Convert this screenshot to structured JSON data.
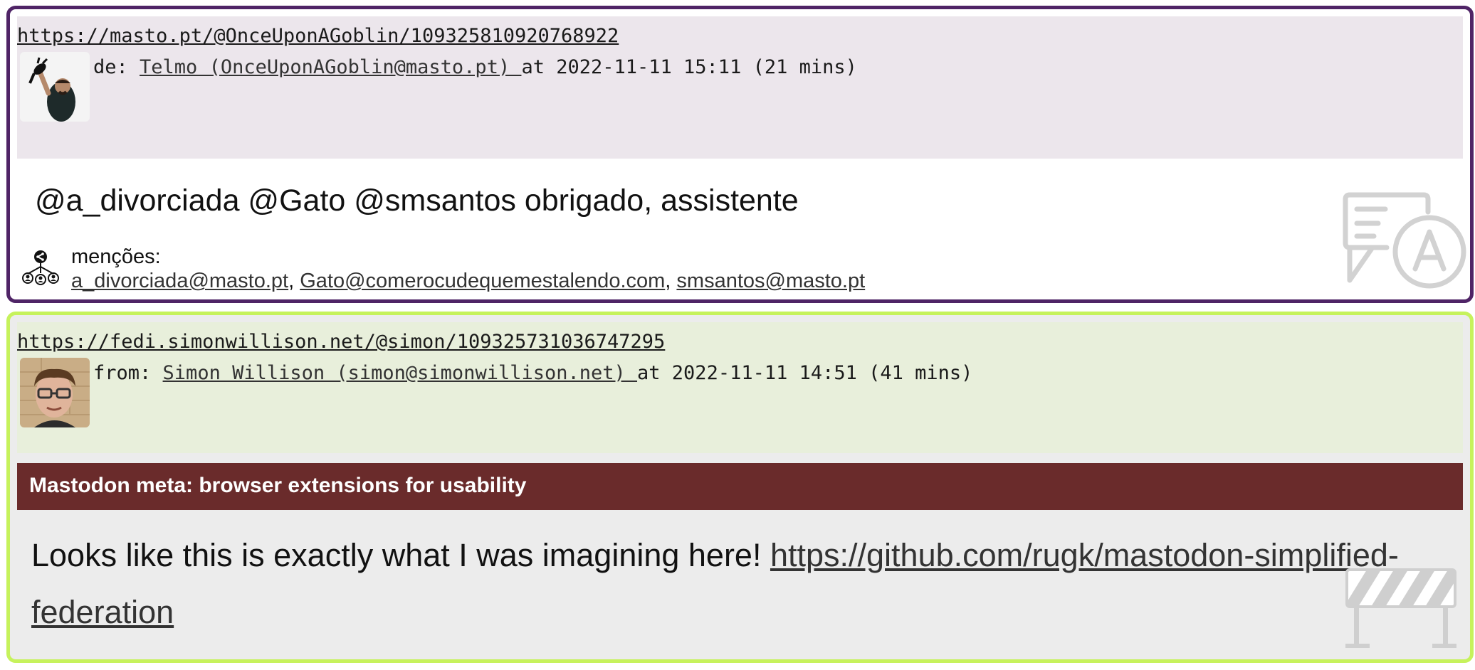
{
  "posts": [
    {
      "url": "https://masto.pt/@OnceUponAGoblin/109325810920768922",
      "from_label": "de: ",
      "author": "Telmo (OnceUponAGoblin@masto.pt) ",
      "at_text": "at 2022-11-11 15:11 (21 mins)",
      "content": "@a_divorciada @Gato @smsantos obrigado, assistente",
      "mentions_label": "menções:",
      "mentions": [
        "a_divorciada@masto.pt",
        "Gato@comerocudequemestalendo.com",
        "smsantos@masto.pt"
      ],
      "mention_separator": ", ",
      "border_color": "#4f2466",
      "header_bg": "#ece6ec",
      "avatar": "avatar-telmo-icon",
      "side_icon": "translate-icon"
    },
    {
      "url": "https://fedi.simonwillison.net/@simon/109325731036747295",
      "from_label": "from: ",
      "author": "Simon Willison (simon@simonwillison.net) ",
      "at_text": "at 2022-11-11 14:51 (41 mins)",
      "content_warning": "Mastodon meta: browser extensions for usability",
      "content_text": "Looks like this is exactly what I was imagining here! ",
      "content_link": "https://github.com/rugk/mastodon-simplified-federation",
      "border_color": "#c6f25c",
      "header_bg": "#e8efdb",
      "cw_bg": "#6a2b2b",
      "avatar": "avatar-simon-icon",
      "side_icon": "construction-barrier-icon"
    }
  ]
}
